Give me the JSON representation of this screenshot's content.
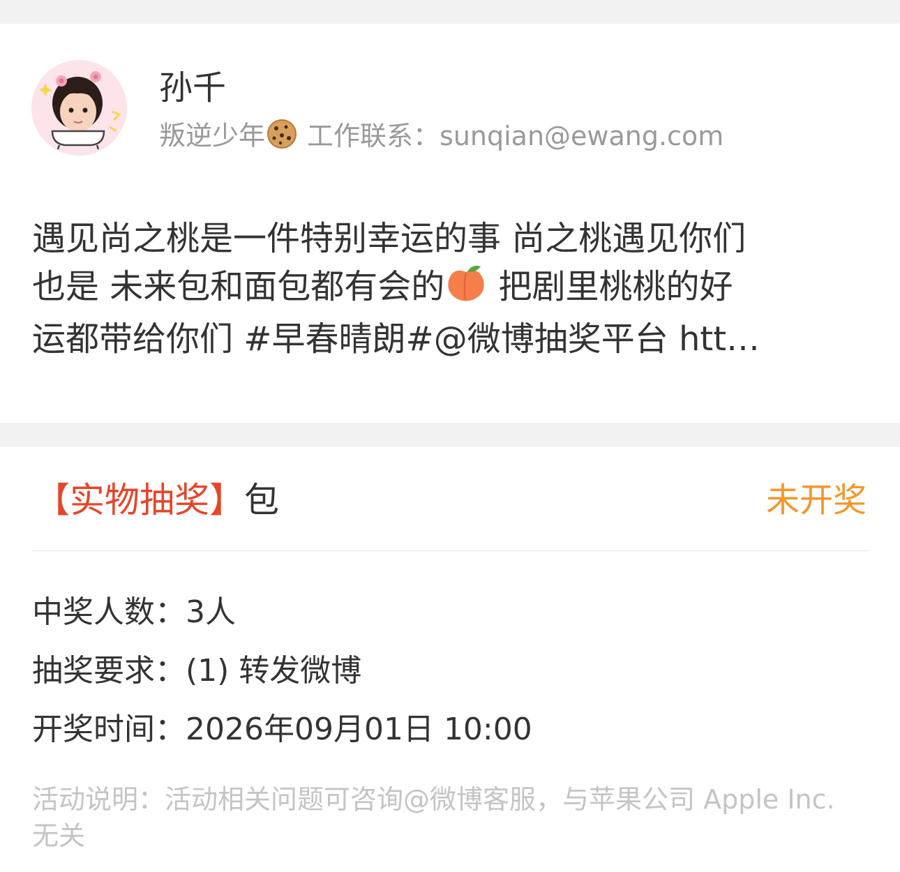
{
  "author": {
    "name": "孙千",
    "bio_prefix": "叛逆少年",
    "bio_emoji": "cookie-icon",
    "bio_suffix": "工作联系：sunqian@ewang.com"
  },
  "post": {
    "line1": "遇见尚之桃是一件特别幸运的事 尚之桃遇见你们",
    "line2a": "也是 未来包和面包都有会的",
    "emoji": "peach-icon",
    "line2b": " 把剧里桃桃的好",
    "line3": "运都带给你们 #早春晴朗#@微博抽奖平台  htt…"
  },
  "lottery": {
    "tag": "【实物抽奖】",
    "prize": "包",
    "status": "未开奖",
    "winners_label": "中奖人数：",
    "winners_value": "3人",
    "requirement_label": "抽奖要求：",
    "requirement_value": "(1) 转发微博",
    "draw_time_label": "开奖时间：",
    "draw_time_value": "2026年09月01日 10:00",
    "note": "活动说明：活动相关问题可咨询@微博客服，与苹果公司 Apple Inc. 无关"
  },
  "colors": {
    "tag_red": "#e4462b",
    "status_orange": "#f3962b",
    "text_gray": "#999999",
    "note_gray": "#c4c4c4",
    "band_gray": "#f2f2f2"
  }
}
